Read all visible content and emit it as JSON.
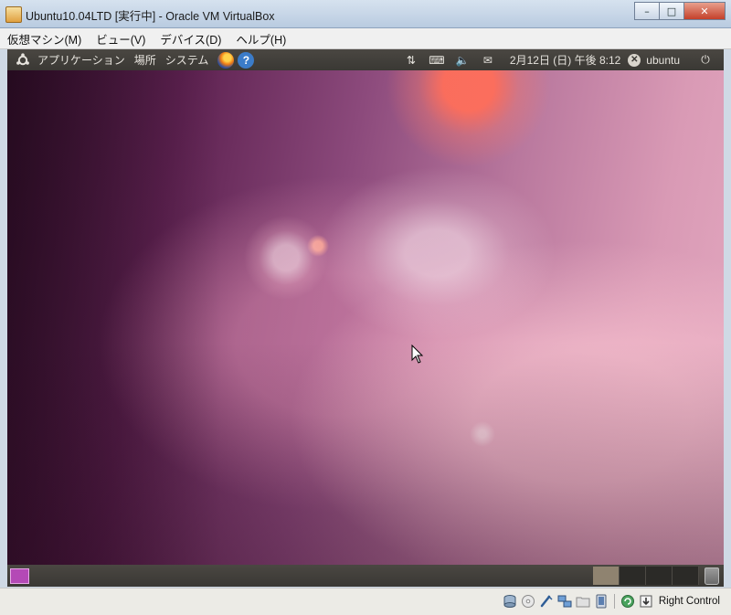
{
  "window": {
    "title": "Ubuntu10.04LTD [実行中] - Oracle VM VirtualBox",
    "minimize_glyph": "–",
    "maximize_glyph": "□",
    "close_glyph": "✕"
  },
  "vbox_menu": {
    "items": [
      {
        "label": "仮想マシン(M)"
      },
      {
        "label": "ビュー(V)"
      },
      {
        "label": "デバイス(D)"
      },
      {
        "label": "ヘルプ(H)"
      }
    ]
  },
  "gnome_top_panel": {
    "menus": [
      {
        "label": "アプリケーション"
      },
      {
        "label": "場所"
      },
      {
        "label": "システム"
      }
    ],
    "launchers": [
      "firefox-icon",
      "help-icon"
    ],
    "help_glyph": "?",
    "tray": {
      "network_glyph": "⇅",
      "keyboard_glyph": "⌨",
      "volume_glyph": "🔈",
      "mail_glyph": "✉"
    },
    "clock": "2月12日 (日) 午後 8:12",
    "user_x_glyph": "✕",
    "user": "ubuntu",
    "power_glyph": "⏻"
  },
  "gnome_bottom_panel": {
    "workspaces": 4,
    "active_workspace": 1
  },
  "vbox_status": {
    "icons": [
      "hard-disk-icon",
      "optical-drive-icon",
      "usb-icon",
      "network-adapters-icon",
      "shared-folders-icon",
      "display-icon",
      "seamless-icon",
      "mouse-integration-icon"
    ],
    "host_key": "Right Control"
  },
  "colors": {
    "panel": "#3a3834",
    "desktop_dark": "#34102c",
    "desktop_light": "#e3a8bf",
    "workspace_active": "#8f8370"
  }
}
